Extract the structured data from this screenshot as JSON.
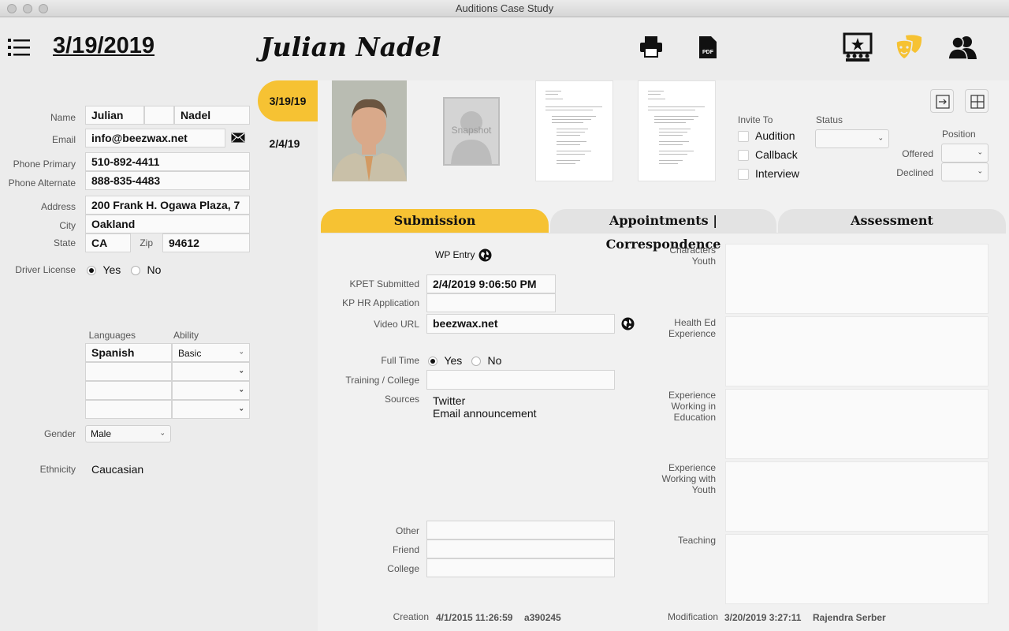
{
  "window": {
    "title": "Auditions Case Study"
  },
  "header": {
    "date": "3/19/2019",
    "name": "Julian Nadel"
  },
  "dates": [
    "3/19/19",
    "2/4/19"
  ],
  "contact": {
    "labels": {
      "name": "Name",
      "email": "Email",
      "phone_primary": "Phone Primary",
      "phone_alternate": "Phone Alternate",
      "address": "Address",
      "city": "City",
      "state": "State",
      "zip": "Zip",
      "driver_license": "Driver License"
    },
    "first_name": "Julian",
    "middle_name": "",
    "last_name": "Nadel",
    "email": "info@beezwax.net",
    "phone_primary": "510-892-4411",
    "phone_alternate": "888-835-4483",
    "address": "200 Frank H. Ogawa Plaza, 7",
    "city": "Oakland",
    "state": "CA",
    "zip": "94612",
    "driver_license": {
      "yes": "Yes",
      "no": "No",
      "selected": "Yes"
    }
  },
  "languages": {
    "col_language": "Languages",
    "col_ability": "Ability",
    "rows": [
      {
        "language": "Spanish",
        "ability": "Basic"
      },
      {
        "language": "",
        "ability": ""
      },
      {
        "language": "",
        "ability": ""
      },
      {
        "language": "",
        "ability": ""
      }
    ]
  },
  "gender": {
    "label": "Gender",
    "value": "Male"
  },
  "ethnicity": {
    "label": "Ethnicity",
    "value": "Caucasian"
  },
  "media": {
    "snapshot_placeholder": "Snapshot"
  },
  "invite": {
    "label": "Invite To",
    "options": [
      "Audition",
      "Callback",
      "Interview"
    ],
    "status_label": "Status",
    "status_value": ""
  },
  "position": {
    "label": "Position",
    "offered": "Offered",
    "declined": "Declined"
  },
  "tabs": [
    "Submission",
    "Appointments | Correspondence",
    "Assessment"
  ],
  "submission": {
    "wp_entry": "WP Entry",
    "kpet_label": "KPET Submitted",
    "kpet_value": "2/4/2019 9:06:50 PM",
    "kphr_label": "KP HR Application",
    "kphr_value": "",
    "video_label": "Video URL",
    "video_value": "beezwax.net",
    "fulltime_label": "Full Time",
    "fulltime_yes": "Yes",
    "fulltime_no": "No",
    "training_label": "Training / College",
    "training_value": "",
    "sources_label": "Sources",
    "sources": [
      "Twitter",
      "Email announcement"
    ],
    "other_label": "Other",
    "friend_label": "Friend",
    "college_label": "College"
  },
  "right_fields": [
    {
      "label": "Characters Youth"
    },
    {
      "label": "Health Ed Experience"
    },
    {
      "label": "Experience Working in Education"
    },
    {
      "label": "Experience Working with Youth"
    },
    {
      "label": "Teaching"
    }
  ],
  "footer": {
    "creation_label": "Creation",
    "creation_date": "4/1/2015 11:26:59",
    "creation_user": "a390245",
    "modification_label": "Modification",
    "modification_date": "3/20/2019 3:27:11",
    "modification_user": "Rajendra Serber"
  },
  "colors": {
    "accent": "#f6c233",
    "tab_inactive": "#e3e3e3"
  },
  "icons": [
    "menu-icon",
    "print-icon",
    "pdf-icon",
    "stage-icon",
    "theater-masks-icon",
    "people-icon",
    "mail-icon",
    "globe-icon",
    "export-icon",
    "add-icon"
  ]
}
